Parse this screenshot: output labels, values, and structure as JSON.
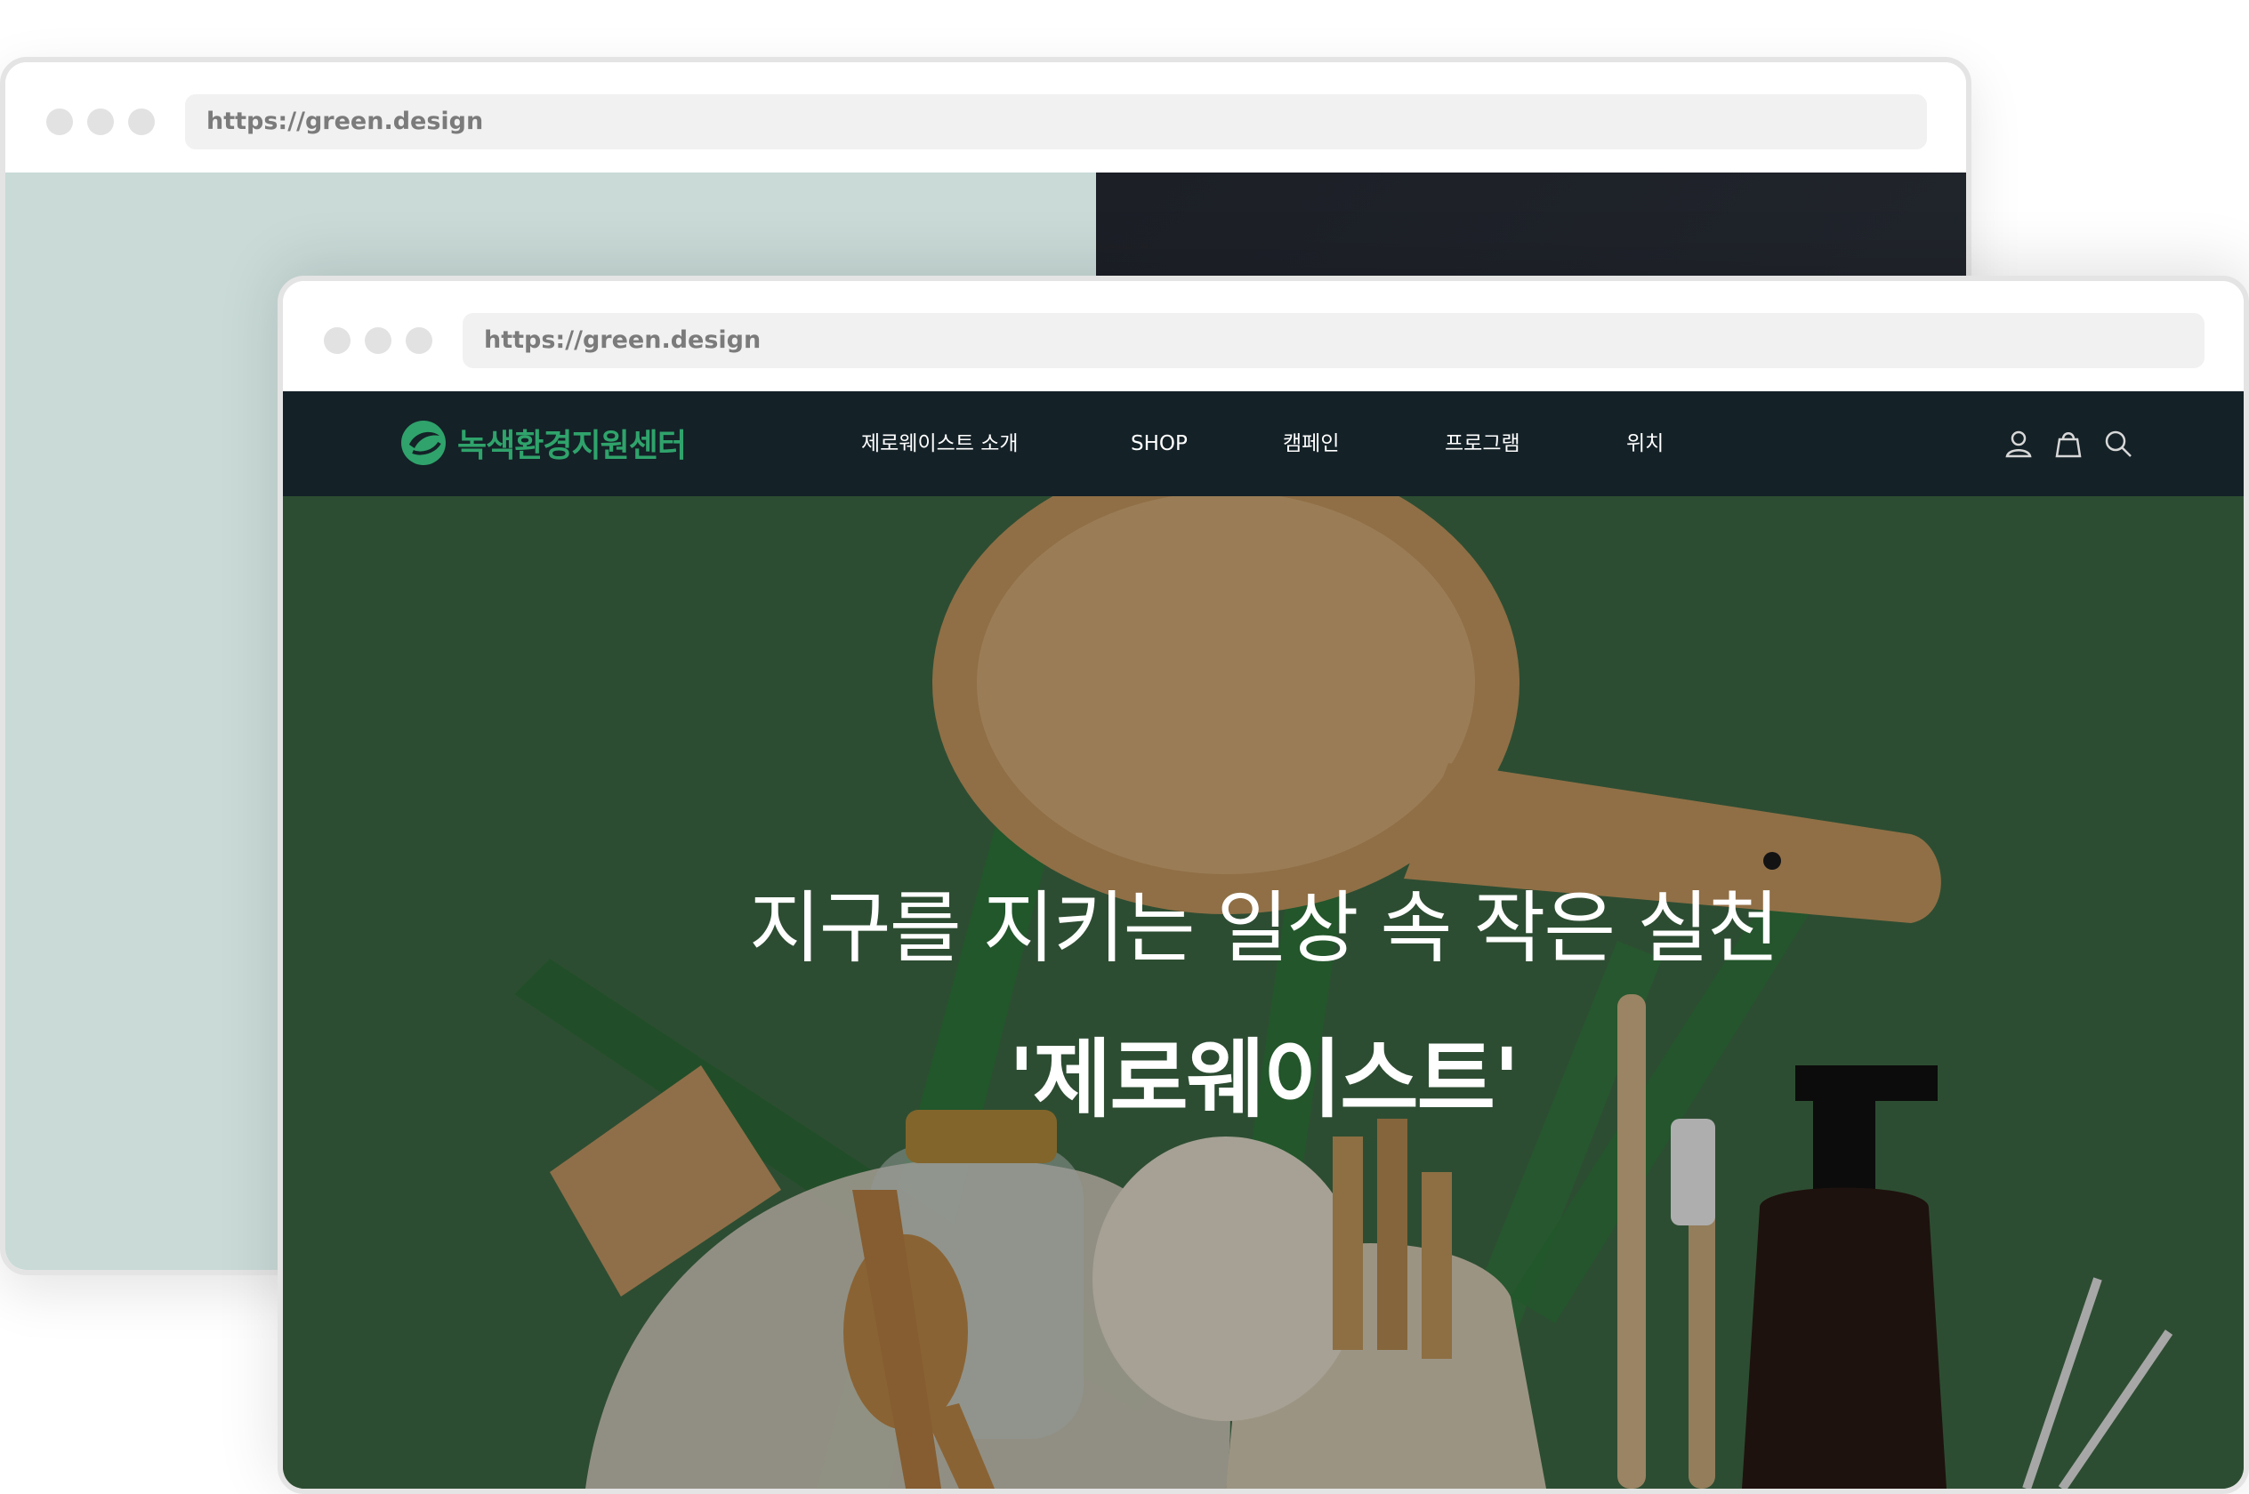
{
  "back_window": {
    "url": "https://green.design"
  },
  "front_window": {
    "url": "https://green.design"
  },
  "site": {
    "logo_text": "녹색환경지원센터",
    "menu": [
      {
        "label": "제로웨이스트 소개"
      },
      {
        "label": "SHOP"
      },
      {
        "label": "캠페인"
      },
      {
        "label": "프로그램"
      },
      {
        "label": "위치"
      }
    ],
    "icons": [
      "user-icon",
      "shopping-bag-icon",
      "search-icon"
    ],
    "hero": {
      "line1": "지구를 지키는 일상 속 작은 실천",
      "line2": "'제로웨이스트'"
    }
  },
  "colors": {
    "nav_bg": "#142127",
    "logo_green": "#2fa36b",
    "hero_green": "#3f6a45",
    "back_panel": "#c9dad7"
  }
}
